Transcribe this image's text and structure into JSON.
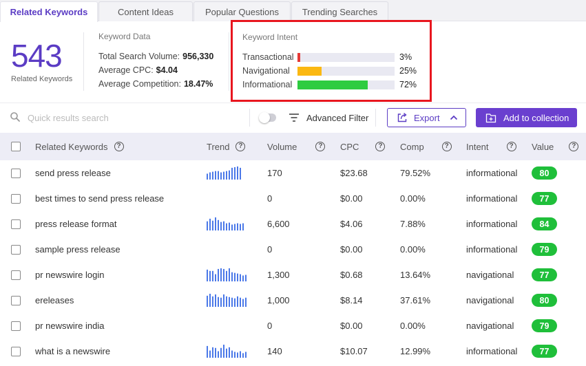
{
  "tabs": [
    {
      "label": "Related Keywords",
      "active": true
    },
    {
      "label": "Content Ideas",
      "active": false
    },
    {
      "label": "Popular Questions",
      "active": false
    },
    {
      "label": "Trending Searches",
      "active": false
    }
  ],
  "summary": {
    "count": "543",
    "count_label": "Related Keywords"
  },
  "keyword_data": {
    "title": "Keyword Data",
    "rows": [
      {
        "label": "Total Search Volume:",
        "value": "956,330"
      },
      {
        "label": "Average CPC:",
        "value": "$4.04"
      },
      {
        "label": "Average Competition:",
        "value": "18.47%"
      }
    ]
  },
  "keyword_intent": {
    "title": "Keyword Intent",
    "rows": [
      {
        "label": "Transactional",
        "pct": "3%",
        "fraction": 0.03,
        "color": "#e53935"
      },
      {
        "label": "Navigational",
        "pct": "25%",
        "fraction": 0.25,
        "color": "#fbb812"
      },
      {
        "label": "Informational",
        "pct": "72%",
        "fraction": 0.72,
        "color": "#2ecc40"
      }
    ]
  },
  "toolbar": {
    "search_placeholder": "Quick results search",
    "filter_label": "Advanced Filter",
    "export_label": "Export",
    "add_label": "Add to collection"
  },
  "table": {
    "headers": {
      "keyword": "Related Keywords",
      "trend": "Trend",
      "volume": "Volume",
      "cpc": "CPC",
      "comp": "Comp",
      "intent": "Intent",
      "value": "Value"
    },
    "rows": [
      {
        "keyword": "send press release",
        "trend": [
          0.45,
          0.55,
          0.6,
          0.65,
          0.65,
          0.55,
          0.6,
          0.65,
          0.7,
          0.9,
          0.95,
          1.0,
          0.9
        ],
        "volume": "170",
        "cpc": "$23.68",
        "comp": "79.52%",
        "intent": "informational",
        "value": "80"
      },
      {
        "keyword": "best times to send press release",
        "trend": [],
        "volume": "0",
        "cpc": "$0.00",
        "comp": "0.00%",
        "intent": "informational",
        "value": "77"
      },
      {
        "keyword": "press release format",
        "trend": [
          0.7,
          0.9,
          0.75,
          1.0,
          0.8,
          0.65,
          0.7,
          0.55,
          0.6,
          0.45,
          0.5,
          0.55,
          0.5,
          0.55
        ],
        "volume": "6,600",
        "cpc": "$4.06",
        "comp": "7.88%",
        "intent": "informational",
        "value": "84"
      },
      {
        "keyword": "sample press release",
        "trend": [],
        "volume": "0",
        "cpc": "$0.00",
        "comp": "0.00%",
        "intent": "informational",
        "value": "79"
      },
      {
        "keyword": "pr newswire login",
        "trend": [
          0.9,
          0.8,
          0.8,
          0.55,
          0.95,
          1.0,
          0.95,
          0.8,
          1.0,
          0.7,
          0.65,
          0.6,
          0.55,
          0.45,
          0.5
        ],
        "volume": "1,300",
        "cpc": "$0.68",
        "comp": "13.64%",
        "intent": "navigational",
        "value": "77"
      },
      {
        "keyword": "ereleases",
        "trend": [
          0.85,
          1.0,
          0.8,
          0.95,
          0.75,
          0.7,
          0.95,
          0.8,
          0.75,
          0.7,
          0.65,
          0.8,
          0.7,
          0.6,
          0.7
        ],
        "volume": "1,000",
        "cpc": "$8.14",
        "comp": "37.61%",
        "intent": "navigational",
        "value": "80"
      },
      {
        "keyword": "pr newswire india",
        "trend": [],
        "volume": "0",
        "cpc": "$0.00",
        "comp": "0.00%",
        "intent": "navigational",
        "value": "79"
      },
      {
        "keyword": "what is a newswire",
        "trend": [
          0.9,
          0.55,
          0.8,
          0.75,
          0.5,
          0.75,
          1.0,
          0.7,
          0.8,
          0.55,
          0.45,
          0.4,
          0.5,
          0.35,
          0.45
        ],
        "volume": "140",
        "cpc": "$10.07",
        "comp": "12.99%",
        "intent": "informational",
        "value": "77"
      }
    ]
  },
  "colors": {
    "accent": "#5b3cc4",
    "button": "#6a3fcf",
    "trend_bar": "#4a78e8",
    "value_badge": "#1fbf3a",
    "highlight_border": "#e8161f"
  }
}
